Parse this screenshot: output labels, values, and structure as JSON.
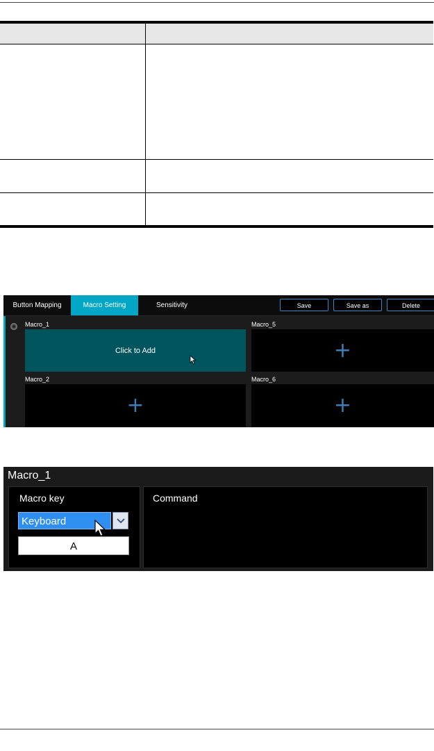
{
  "macro_page": {
    "tabs": [
      {
        "label": "Button Mapping"
      },
      {
        "label": "Macro Setting"
      },
      {
        "label": "Sensitivity"
      }
    ],
    "actions": {
      "save": "Save",
      "save_as": "Save as",
      "delete": "Delete"
    },
    "slots": [
      {
        "label": "Macro_1",
        "text": "Click to Add"
      },
      {
        "label": "Macro_5",
        "text": "+"
      },
      {
        "label": "Macro_2",
        "text": "+"
      },
      {
        "label": "Macro_6",
        "text": "+"
      }
    ]
  },
  "macro_editor": {
    "title": "Macro_1",
    "macro_key_label": "Macro key",
    "key_type": "Keyboard",
    "key_value": "A",
    "command_label": "Command"
  },
  "colors": {
    "active_tab": "#00a7c4",
    "active_slot": "#00545e",
    "plus": "#3d7fb5",
    "selected_option": "#2f8ff0"
  },
  "icons": [
    "radio-icon",
    "mouse-pointer-icon",
    "plus-icon",
    "chevron-down-icon"
  ]
}
